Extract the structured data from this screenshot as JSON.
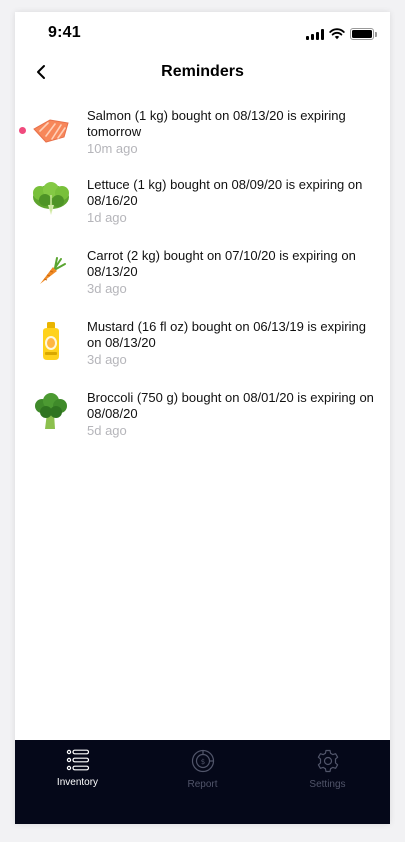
{
  "status_bar": {
    "time": "9:41"
  },
  "header": {
    "title": "Reminders"
  },
  "reminders": [
    {
      "message": "Salmon (1 kg) bought on 08/13/20 is expiring tomorrow",
      "time": "10m ago",
      "unread": true,
      "icon": "salmon-icon"
    },
    {
      "message": "Lettuce (1 kg) bought on 08/09/20 is expiring on 08/16/20",
      "time": "1d ago",
      "unread": false,
      "icon": "lettuce-icon"
    },
    {
      "message": "Carrot (2 kg) bought on 07/10/20 is expiring on 08/13/20",
      "time": "3d ago",
      "unread": false,
      "icon": "carrot-icon"
    },
    {
      "message": "Mustard (16 fl oz) bought on 06/13/19 is expiring on 08/13/20",
      "time": "3d ago",
      "unread": false,
      "icon": "mustard-icon"
    },
    {
      "message": "Broccoli (750 g) bought on 08/01/20 is expiring on 08/08/20",
      "time": "5d ago",
      "unread": false,
      "icon": "broccoli-icon"
    }
  ],
  "tab_bar": {
    "tabs": [
      {
        "label": "Inventory",
        "icon": "inventory-icon",
        "active": true
      },
      {
        "label": "Report",
        "icon": "report-icon",
        "active": false
      },
      {
        "label": "Settings",
        "icon": "settings-icon",
        "active": false
      }
    ]
  },
  "colors": {
    "unread_dot": "#f04a7d",
    "tab_bar_bg": "#050819",
    "tab_active": "#ffffff",
    "tab_inactive": "#51556a",
    "timestamp": "#b5b5ba"
  }
}
